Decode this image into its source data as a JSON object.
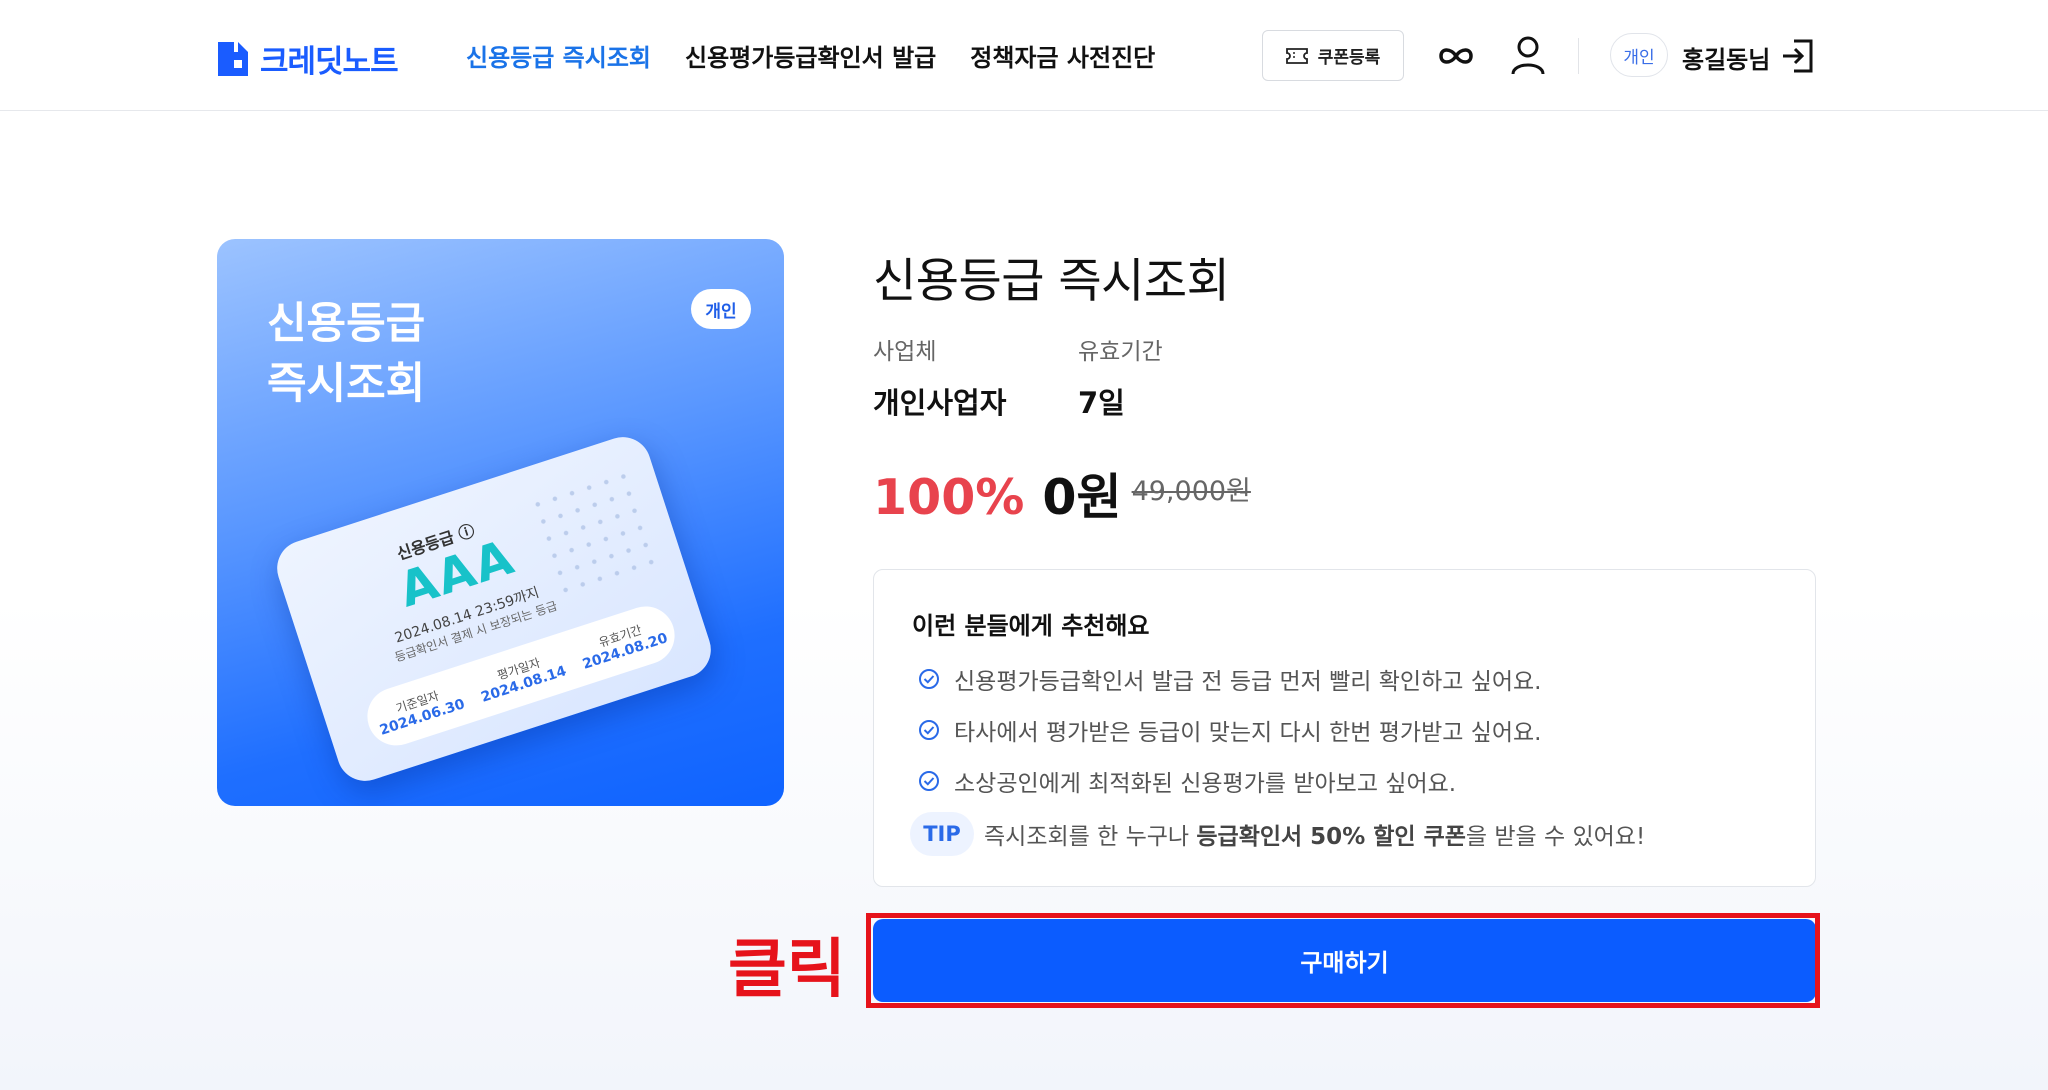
{
  "header": {
    "logo_text": "크레딧노트",
    "nav": [
      {
        "label": "신용등급 즉시조회",
        "active": true
      },
      {
        "label": "신용평가등급확인서 발급",
        "active": false
      },
      {
        "label": "정책자금 사전진단",
        "active": false
      }
    ],
    "coupon_label": "쿠폰등록",
    "badge": "개인",
    "user_name": "홍길동님",
    "icons": [
      "logo-icon",
      "ticket-icon",
      "infinity-icon",
      "user-icon",
      "logout-icon"
    ]
  },
  "card": {
    "title": "신용등급\n즉시조회",
    "badge": "개인",
    "credit": {
      "label": "신용등급 ⓘ",
      "grade": "AAA",
      "valid_until": "2024.08.14 23:59까지",
      "note": "등급확인서 결제 시 보장되는 등급",
      "cols": [
        {
          "label": "기준일자",
          "value": "2024.06.30"
        },
        {
          "label": "평가일자",
          "value": "2024.08.14"
        },
        {
          "label": "유효기간",
          "value": "2024.08.20"
        }
      ]
    }
  },
  "product": {
    "title": "신용등급 즉시조회",
    "meta": [
      {
        "label": "사업체",
        "value": "개인사업자"
      },
      {
        "label": "유효기간",
        "value": "7일"
      }
    ],
    "discount": "100%",
    "price": "0원",
    "original_price": "49,000원"
  },
  "recommend": {
    "title": "이런 분들에게 추천해요",
    "items": [
      "신용평가등급확인서 발급 전 등급 먼저 빨리 확인하고 싶어요.",
      "타사에서 평가받은 등급이 맞는지 다시 한번 평가받고 싶어요.",
      "소상공인에게 최적화된 신용평가를 받아보고 싶어요."
    ],
    "tip_badge": "TIP",
    "tip_prefix": "즉시조회를 한 누구나 ",
    "tip_strong": "등급확인서 50% 할인 쿠폰",
    "tip_suffix": "을 받을 수 있어요!"
  },
  "buy_label": "구매하기",
  "annotation": {
    "click_label": "클릭",
    "color": "#e6131b"
  },
  "colors": {
    "brand": "#1a5cff",
    "accent_red": "#e8434d",
    "button": "#0b5cff"
  }
}
